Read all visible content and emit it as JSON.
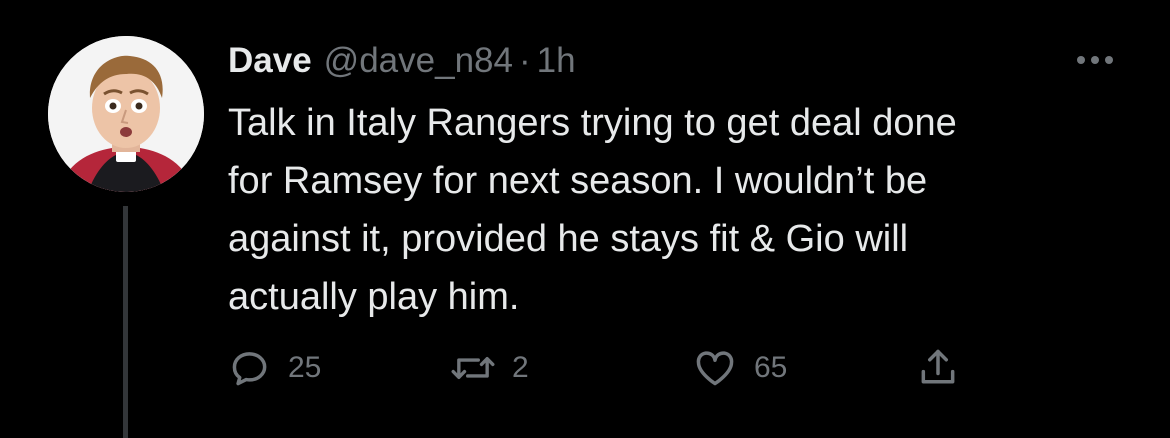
{
  "tweet": {
    "author": {
      "display_name": "Dave",
      "handle": "@dave_n84"
    },
    "separator": "·",
    "time": "1h",
    "text_lines": [
      "Talk in Italy Rangers trying to get deal done",
      "for Ramsey for next season. I wouldn’t be",
      "against it, provided he stays fit & Gio will",
      "actually play him."
    ],
    "actions": {
      "reply": {
        "icon": "reply-icon",
        "count": "25"
      },
      "retweet": {
        "icon": "retweet-icon",
        "count": "2"
      },
      "like": {
        "icon": "heart-icon",
        "count": "65"
      },
      "share": {
        "icon": "share-icon"
      }
    },
    "more_icon": "more-options-icon"
  },
  "colors": {
    "background": "#000000",
    "primary_text": "#e7e9ea",
    "secondary_text": "#71767b",
    "thread_line": "#333639"
  }
}
